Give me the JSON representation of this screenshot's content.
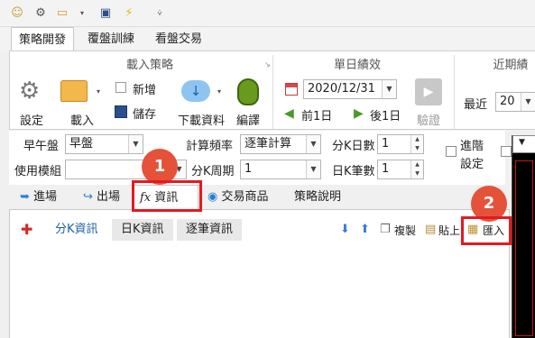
{
  "ribbon_tabs": [
    "策略開發",
    "覆盤訓練",
    "看盤交易"
  ],
  "groups": {
    "load": {
      "title": "載入策略",
      "settings_label": "設定",
      "load_label": "載入",
      "new_label": "新增",
      "save_label": "儲存",
      "download_label": "下載資料",
      "compile_label": "編譯"
    },
    "single": {
      "title": "單日績效",
      "date": "2020/12/31",
      "prev_label": "前1日",
      "next_label": "後1日",
      "verify_label": "驗證"
    },
    "recent": {
      "title": "近期績",
      "recent_label": "最近",
      "recent_value": "20"
    }
  },
  "form": {
    "session_label": "早午盤",
    "session_value": "早盤",
    "calc_label": "計算頻率",
    "calc_value": "逐筆計算",
    "kmin_days_label": "分K日數",
    "kmin_days_value": "1",
    "model_label": "使用模組",
    "model_value": "",
    "kmin_period_label": "分K周期",
    "kmin_period_value": "1",
    "kday_label": "日K筆數",
    "kday_value": "1",
    "advanced_label_line1": "進階",
    "advanced_label_line2": "設定"
  },
  "tabs1": [
    "進場",
    "出場",
    "資訊",
    "交易商品",
    "策略說明"
  ],
  "tabs2": [
    "分K資訊",
    "日K資訊",
    "逐筆資訊"
  ],
  "toolbar": {
    "copy_label": "複製",
    "paste_label": "貼上",
    "import_label": "匯入"
  },
  "markers": [
    "1",
    "2"
  ],
  "colors": {
    "accent": "#1f5fa8",
    "marker": "#e5523a",
    "highlight": "#e4191f"
  }
}
